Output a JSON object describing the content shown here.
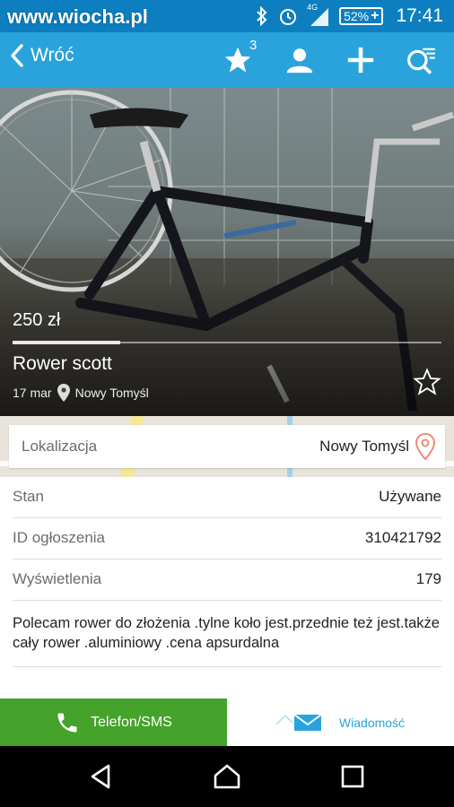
{
  "status_bar": {
    "watermark": "www.wiocha.pl",
    "network": "4G",
    "battery": "52%",
    "time": "17:41",
    "icons": [
      "bluetooth-icon",
      "alarm-icon",
      "signal-icon",
      "battery-icon"
    ]
  },
  "app_bar": {
    "back_label": "Wróć",
    "favorites_count": "3",
    "icons": [
      "star-icon",
      "user-icon",
      "plus-icon",
      "search-icon"
    ]
  },
  "listing": {
    "price": "250 zł",
    "title": "Rower scott",
    "date": "17 mar",
    "city": "Nowy Tomyśl",
    "gallery_progress": 0.25
  },
  "location": {
    "label": "Lokalizacja",
    "value": "Nowy Tomyśl"
  },
  "details": [
    {
      "label": "Stan",
      "value": "Używane"
    },
    {
      "label": "ID ogłoszenia",
      "value": "310421792"
    },
    {
      "label": "Wyświetlenia",
      "value": "179"
    }
  ],
  "description": "Polecam rower do złożenia .tylne koło jest.przednie też jest.także cały rower .aluminiowy .cena apsurdalna",
  "actions": {
    "call_label": "Telefon/SMS",
    "message_label": "Wiadomość"
  },
  "colors": {
    "status_bar": "#0d7fc0",
    "app_bar": "#2aa3dc",
    "call_button": "#45a22a",
    "accent": "#2aa3dc"
  }
}
